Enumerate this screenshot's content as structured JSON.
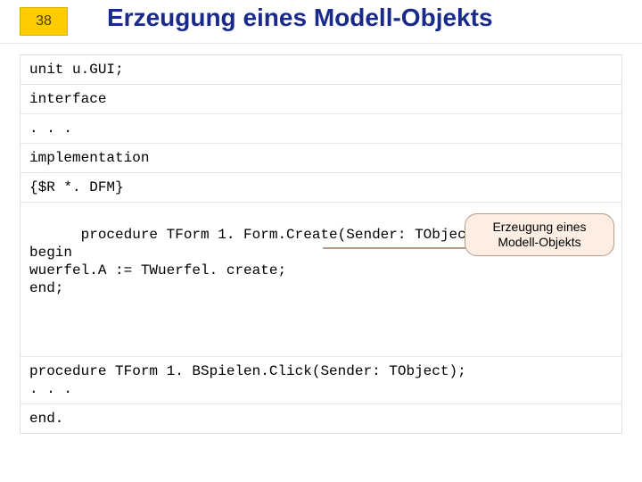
{
  "page_number": "38",
  "title": "Erzeugung eines Modell-Objekts",
  "code": {
    "row1": "unit u.GUI;",
    "row2": "interface",
    "row3": ". . .",
    "row4": "implementation",
    "row5": "{$R *. DFM}",
    "row6": "procedure TForm 1. Form.Create(Sender: TObject);\nbegin\nwuerfel.A := TWuerfel. create;\nend;",
    "row7": "procedure TForm 1. BSpielen.Click(Sender: TObject);\n. . .",
    "row8": "end."
  },
  "callout": "Erzeugung eines Modell-Objekts"
}
